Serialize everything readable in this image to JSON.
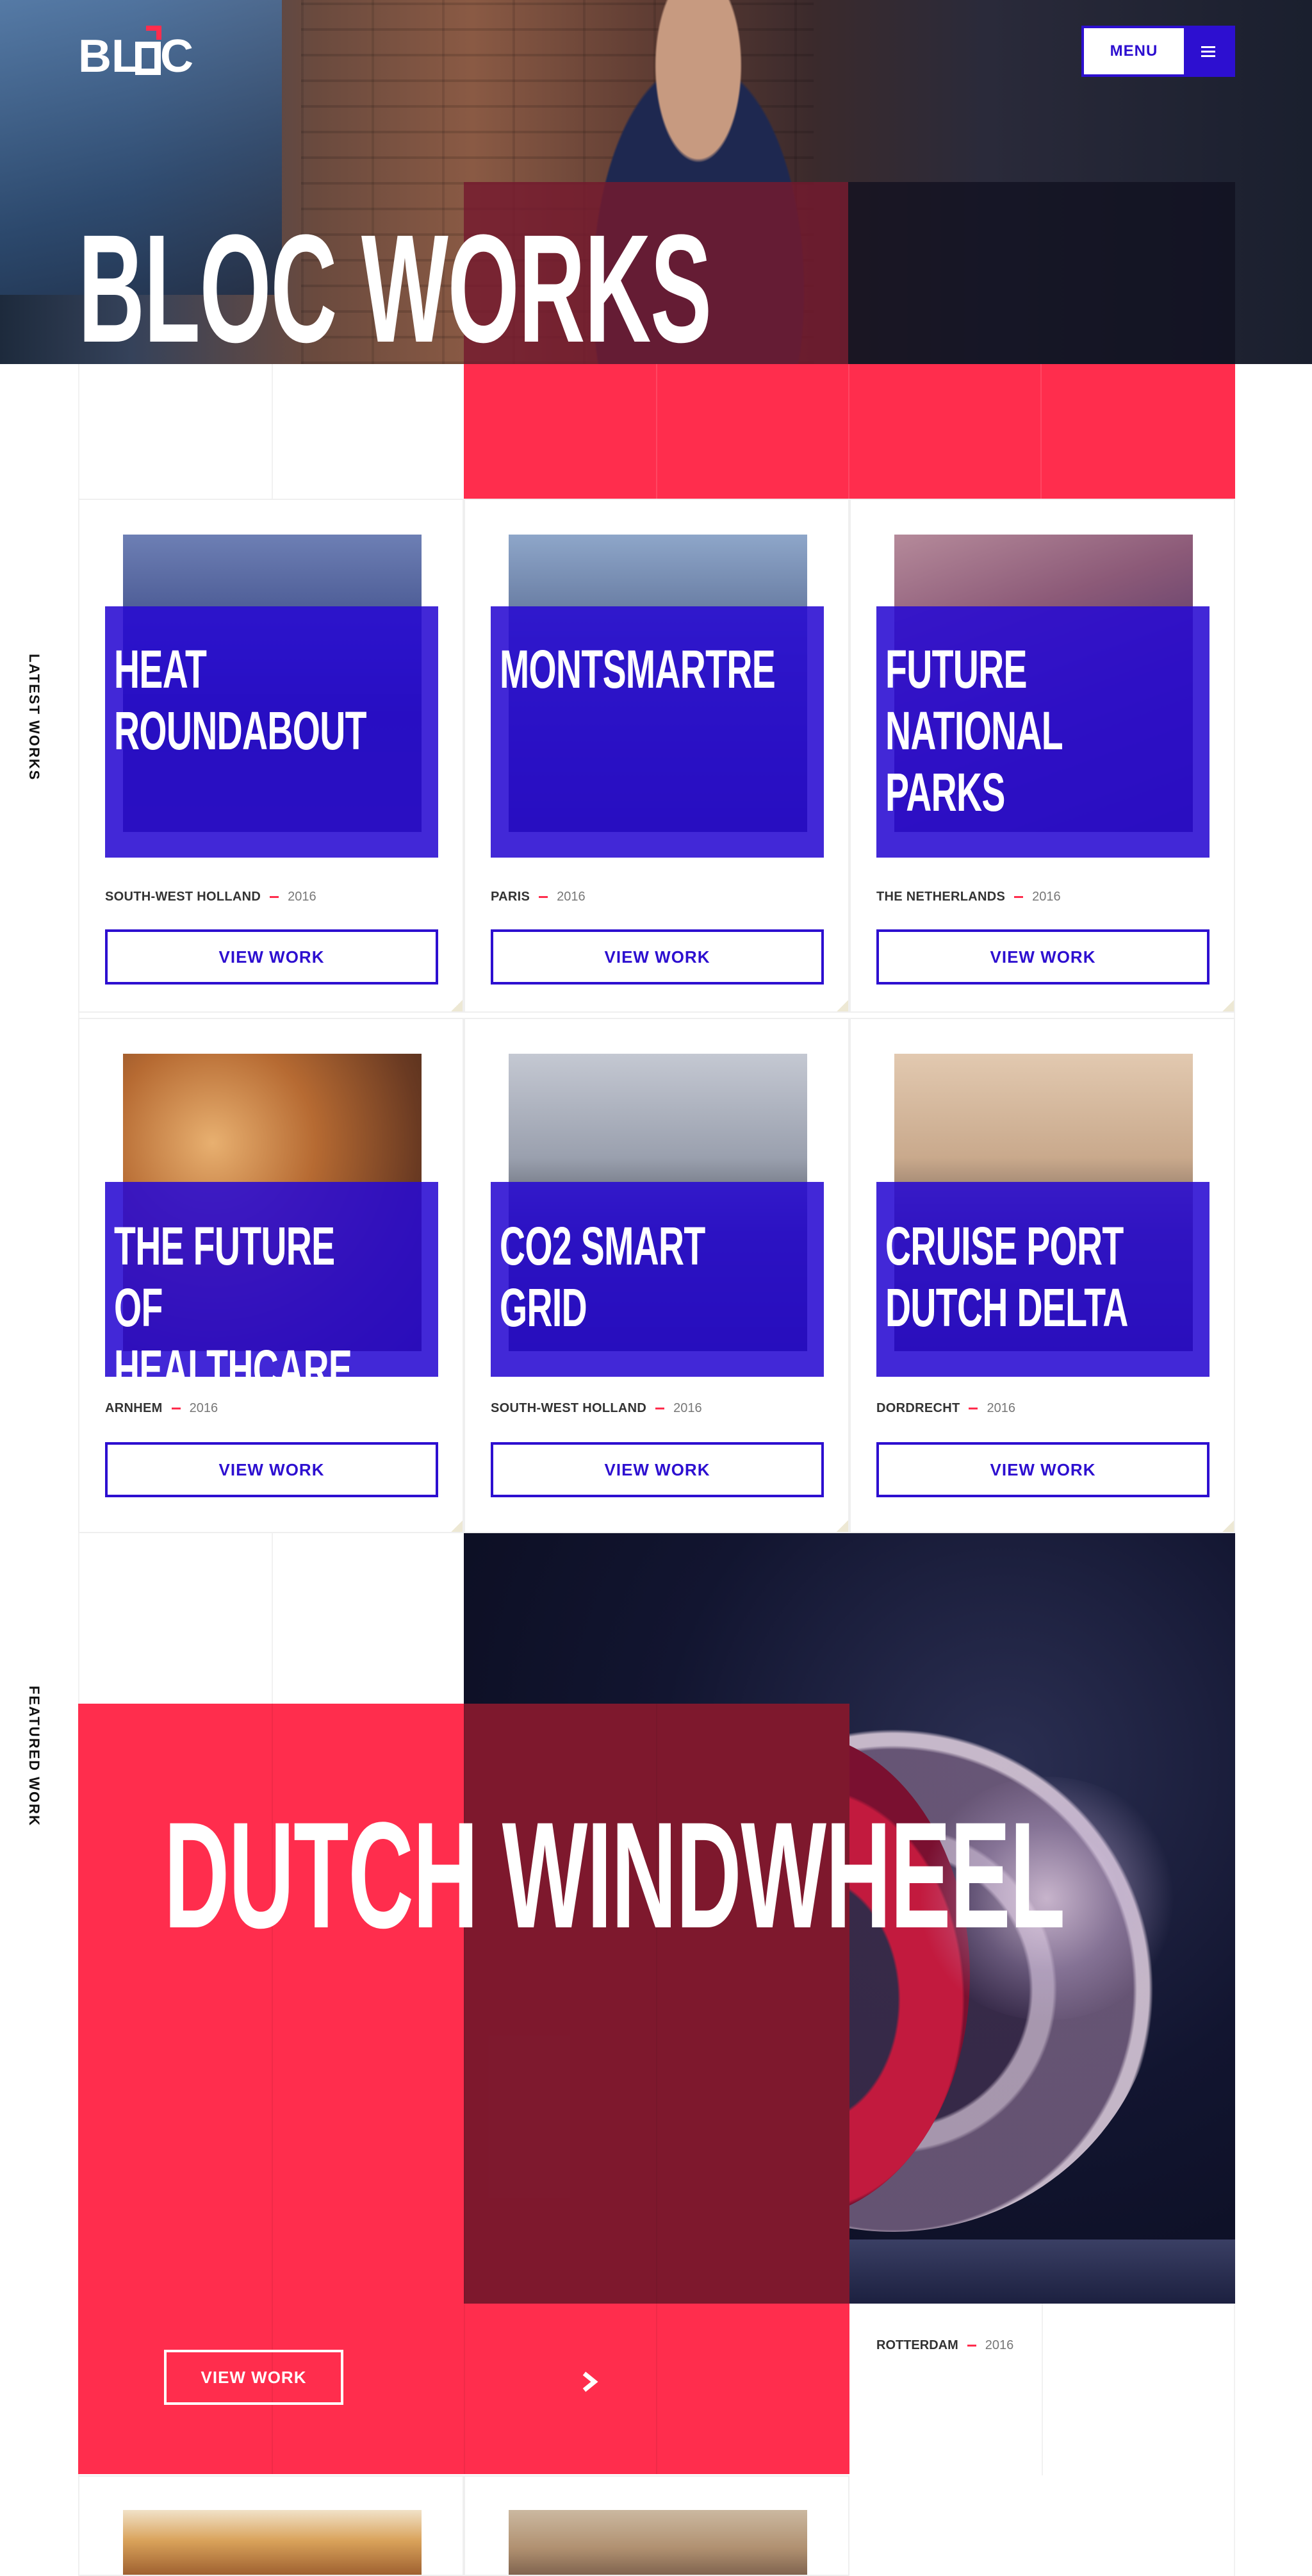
{
  "header": {
    "logo_alt": "BLOC",
    "menu_label": "MENU",
    "hero_title": "BLOC WORKS"
  },
  "sections": {
    "latest": "LATEST WORKS",
    "featured": "FEATURED WORK"
  },
  "cards": [
    {
      "title": "HEAT ROUNDABOUT",
      "location": "SOUTH-WEST HOLLAND",
      "year": "2016",
      "button": "VIEW WORK"
    },
    {
      "title": "MONTSMARTRE",
      "location": "PARIS",
      "year": "2016",
      "button": "VIEW WORK"
    },
    {
      "title": "FUTURE NATIONAL PARKS",
      "location": "THE NETHERLANDS",
      "year": "2016",
      "button": "VIEW WORK"
    },
    {
      "title": "THE FUTURE OF HEALTHCARE",
      "location": "ARNHEM",
      "year": "2016",
      "button": "VIEW WORK"
    },
    {
      "title": "CO2 SMART GRID",
      "location": "SOUTH-WEST HOLLAND",
      "year": "2016",
      "button": "VIEW WORK"
    },
    {
      "title": "CRUISE PORT DUTCH DELTA",
      "location": "DORDRECHT",
      "year": "2016",
      "button": "VIEW WORK"
    }
  ],
  "featured": {
    "title": "DUTCH WINDWHEEL",
    "button": "VIEW WORK",
    "location": "ROTTERDAM",
    "year": "2016"
  },
  "colors": {
    "accent_red": "#ff2d4d",
    "accent_blue": "#2d0fd0"
  },
  "icons": {
    "menu": "hamburger-icon",
    "next": "chevron-right-icon"
  }
}
